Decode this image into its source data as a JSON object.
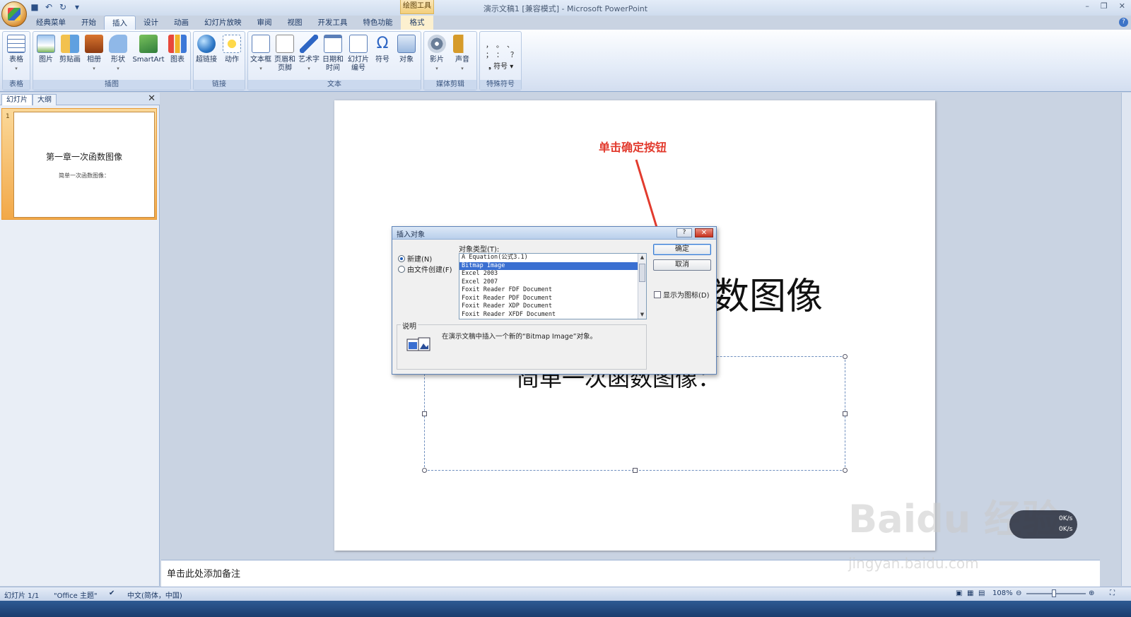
{
  "app": {
    "title": "演示文稿1 [兼容模式] - Microsoft PowerPoint",
    "context_tool": "绘图工具"
  },
  "tabs": [
    "经典菜单",
    "开始",
    "插入",
    "设计",
    "动画",
    "幻灯片放映",
    "审阅",
    "视图",
    "开发工具",
    "特色功能"
  ],
  "active_tab": "插入",
  "format_tab": "格式",
  "ribbon": {
    "groups": {
      "table": "表格",
      "illustrations": "插图",
      "links": "链接",
      "text": "文本",
      "media": "媒体剪辑",
      "special": "特殊符号"
    },
    "buttons": {
      "table": "表格",
      "picture": "图片",
      "clipart": "剪贴画",
      "album": "相册",
      "shapes": "形状",
      "smartart": "SmartArt",
      "chart": "图表",
      "hyperlink": "超链接",
      "action": "动作",
      "textbox": "文本框",
      "header_footer_1": "页眉和",
      "header_footer_2": "页脚",
      "wordart": "艺术字",
      "datetime_1": "日期和",
      "datetime_2": "时间",
      "slide_number_1": "幻灯片",
      "slide_number_2": "编号",
      "symbol": "符号",
      "object": "对象",
      "movie": "影片",
      "sound": "声音",
      "special_symbol": "符号"
    }
  },
  "slides_pane": {
    "tab_slides": "幻灯片",
    "tab_outline": "大纲",
    "thumb_number": "1",
    "thumb_title": "第一章一次函数图像",
    "thumb_subtitle": "简单一次函数图像："
  },
  "slide": {
    "title_visible": "数图像",
    "subtitle_visible": "简单一次函数图像："
  },
  "annotation": "单击确定按钮",
  "dialog": {
    "title": "插入对象",
    "radio_new": "新建(N)",
    "radio_from_file": "由文件创建(F)",
    "type_label": "对象类型(T):",
    "object_types": [
      "A Equation(公式3.1)",
      "Bitmap Image",
      "Excel 2003",
      "Excel 2007",
      "Foxit Reader FDF Document",
      "Foxit Reader PDF Document",
      "Foxit Reader XDP Document",
      "Foxit Reader XFDF Document"
    ],
    "selected_type": "Bitmap Image",
    "ok": "确定",
    "cancel": "取消",
    "show_as_icon": "显示为图标(D)",
    "desc_label": "说明",
    "desc_text": "在演示文稿中插入一个新的“Bitmap Image”对象。"
  },
  "notes_placeholder": "单击此处添加备注",
  "status": {
    "slide_info": "幻灯片 1/1",
    "theme": "\"Office 主题\"",
    "language": "中文(简体，中国)",
    "zoom": "108%"
  },
  "watermark": {
    "brand": "Baidu 经验",
    "url": "jingyan.baidu.com"
  },
  "net_monitor": {
    "up": "0K/s",
    "down": "0K/s"
  }
}
